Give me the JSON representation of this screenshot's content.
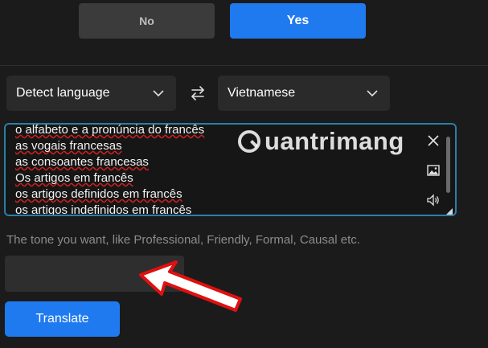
{
  "choice": {
    "no_label": "No",
    "yes_label": "Yes"
  },
  "languages": {
    "source": "Detect language",
    "target": "Vietnamese",
    "swap_icon": "swap-arrows-icon",
    "chevron_icon": "chevron-down-icon"
  },
  "input_text": {
    "lines": [
      "o alfabeto e a pronúncia do francês",
      "as vogais francesas",
      "as consoantes francesas",
      "Os artigos em francês",
      "os artigos definidos em francês",
      "os artigos indefinidos em francês"
    ],
    "icons": [
      "close-icon",
      "image-icon",
      "speaker-icon"
    ]
  },
  "watermark": "uantrimang",
  "tone": {
    "placeholder": "The tone you want, like Professional, Friendly, Formal, Causal etc.",
    "value": ""
  },
  "actions": {
    "translate_label": "Translate"
  },
  "colors": {
    "accent": "#1f7af0",
    "focus_border": "#2b7ea8",
    "annotation_arrow": "#e01010"
  }
}
